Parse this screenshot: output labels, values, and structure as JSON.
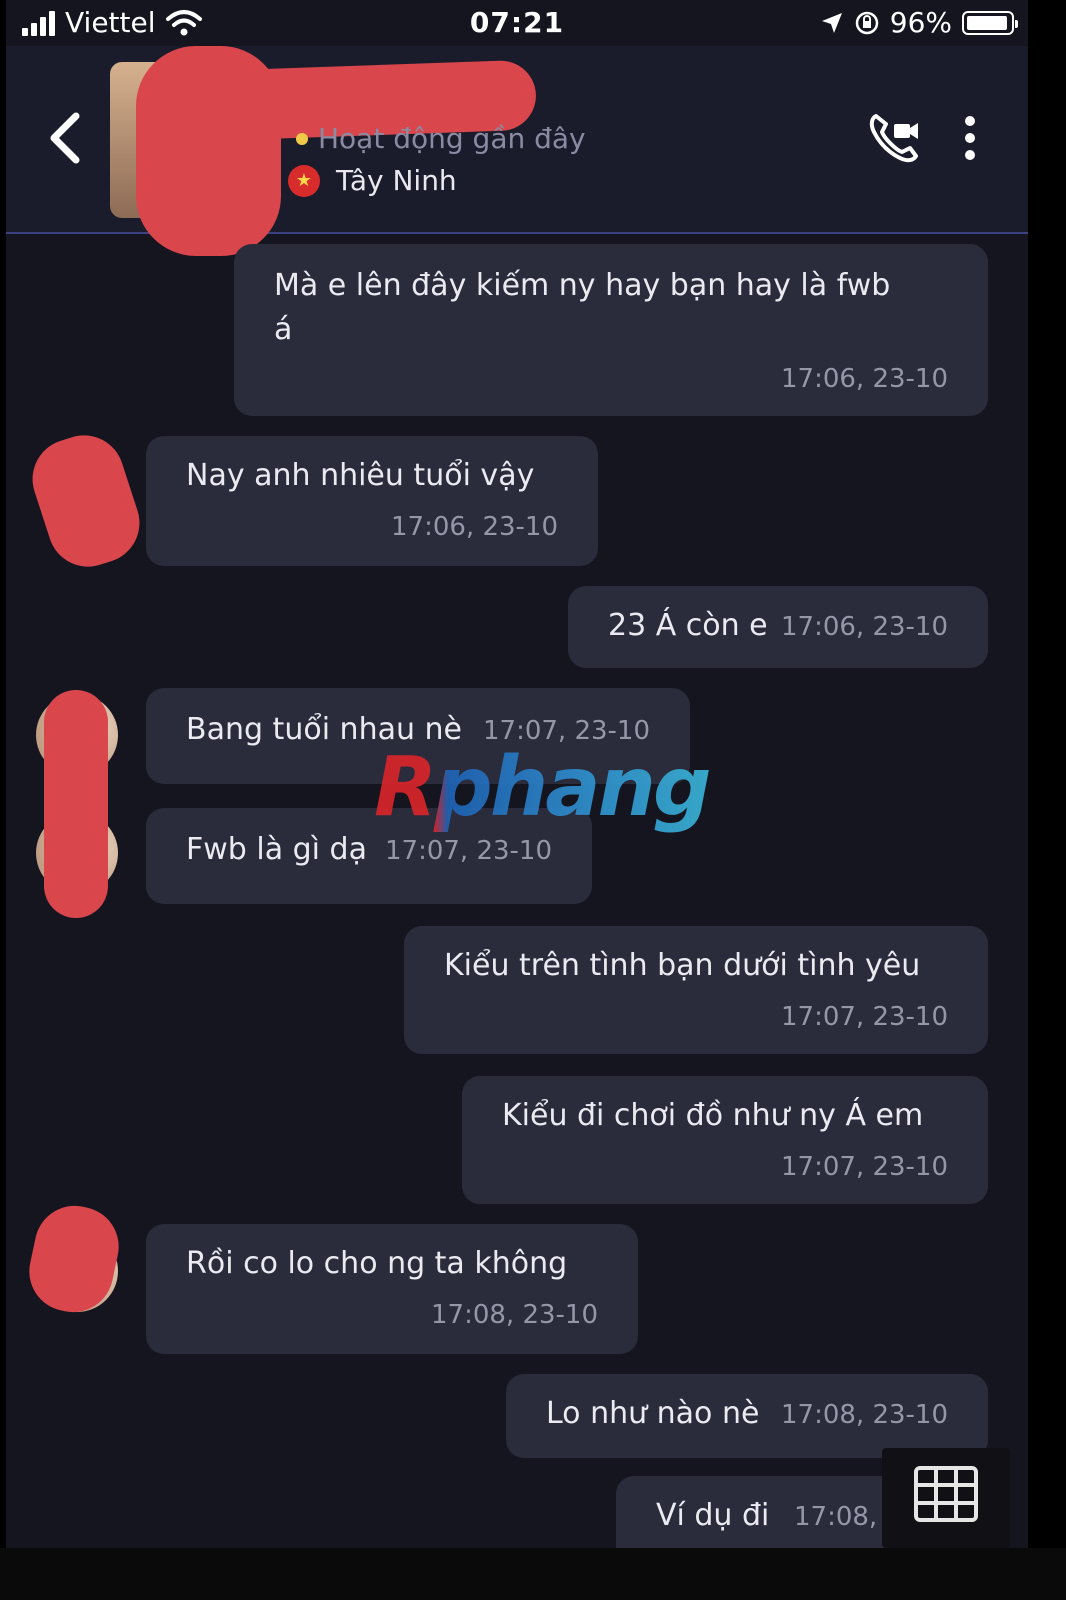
{
  "status_bar": {
    "carrier": "Viettel",
    "time": "07:21",
    "battery": "96%",
    "battery_level": 0.96
  },
  "header": {
    "status_text": "Hoạt động gần đây",
    "location": "Tây Ninh",
    "status_dot_color": "#f1c94a"
  },
  "messages": [
    {
      "side": "outgoing",
      "line1": "Mà e lên đây kiếm ny hay bạn hay là fwb",
      "line2": "á",
      "time": "17:06, 23-10"
    },
    {
      "side": "incoming",
      "text": "Nay anh nhiêu tuổi vậy",
      "time": "17:06, 23-10"
    },
    {
      "side": "outgoing",
      "text": "23 Á còn e",
      "time": "17:06, 23-10"
    },
    {
      "side": "incoming",
      "text": "Bang tuổi nhau nè",
      "time": "17:07, 23-10"
    },
    {
      "side": "incoming",
      "text": "Fwb là gì dạ",
      "time": "17:07, 23-10"
    },
    {
      "side": "outgoing",
      "text": "Kiểu trên tình bạn dưới tình yêu",
      "time": "17:07, 23-10"
    },
    {
      "side": "outgoing",
      "text": "Kiểu đi chơi đồ như ny Á em",
      "time": "17:07, 23-10"
    },
    {
      "side": "incoming",
      "text": "Rồi co lo cho ng ta không",
      "time": "17:08, 23-10"
    },
    {
      "side": "outgoing",
      "text": "Lo như nào nè",
      "time": "17:08, 23-10"
    },
    {
      "side": "outgoing",
      "text": "Ví dụ đi",
      "time": "17:08,"
    }
  ],
  "watermark": "Rphang",
  "colors": {
    "background": "#151520",
    "bubble": "#2a2c3c",
    "redaction": "#d9464c",
    "header_border": "#3d4280"
  },
  "icons": {
    "back": "chevron-left-icon",
    "call": "video-call-icon",
    "more": "more-vertical-icon",
    "keyboard": "grid-icon"
  }
}
